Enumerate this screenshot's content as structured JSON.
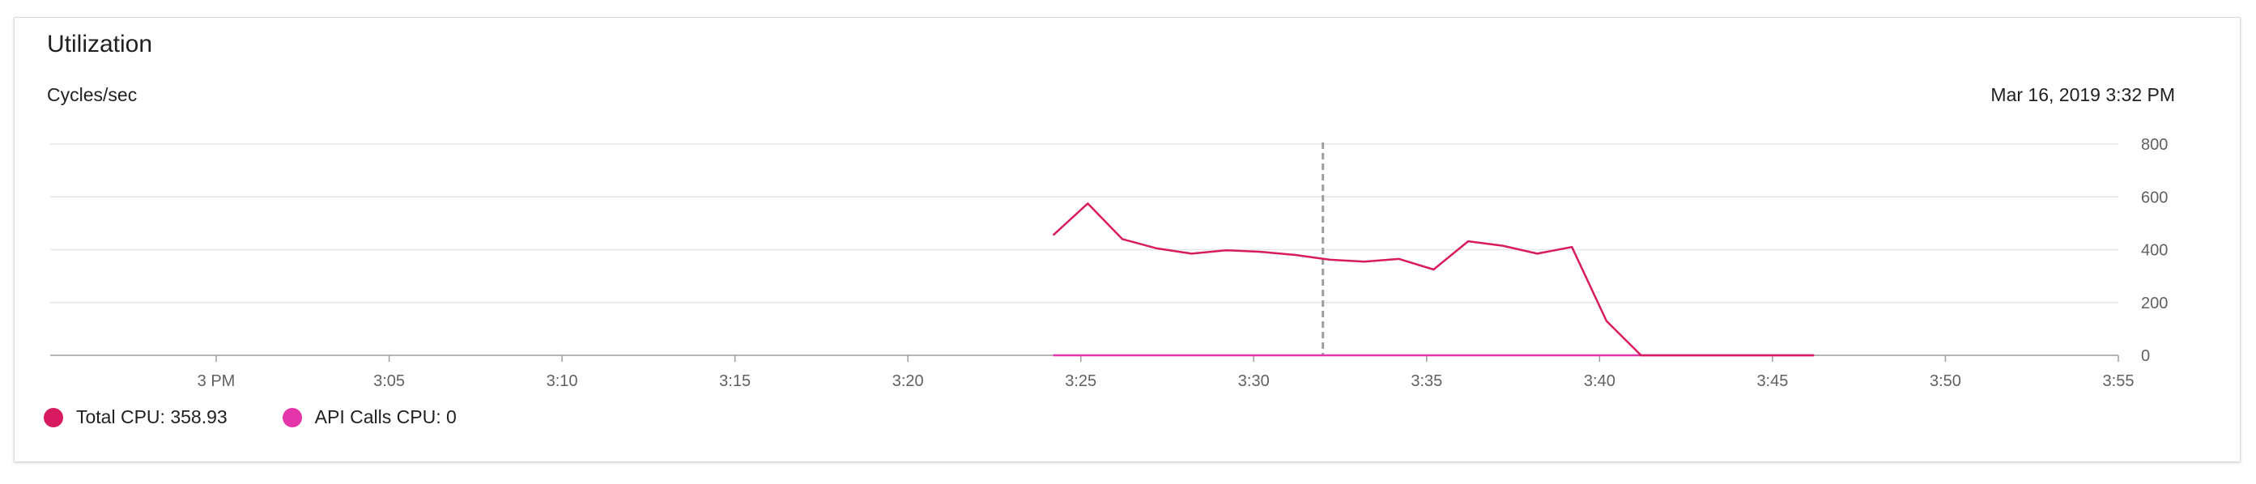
{
  "card": {
    "title": "Utilization",
    "metric_label": "Cycles/sec",
    "timestamp": "Mar 16, 2019 3:32 PM"
  },
  "legend": [
    {
      "label": "Total CPU: 358.93",
      "color": "#d81b60"
    },
    {
      "label": "API Calls CPU: 0",
      "color": "#e535ab"
    }
  ],
  "chart_data": {
    "type": "line",
    "xlabel": "",
    "ylabel": "Cycles/sec",
    "x_ticks": [
      "3 PM",
      "3:05",
      "3:10",
      "3:15",
      "3:20",
      "3:25",
      "3:30",
      "3:35",
      "3:40",
      "3:45",
      "3:50",
      "3:55"
    ],
    "y_ticks": [
      0,
      200,
      400,
      600,
      800
    ],
    "xlim_minutes": [
      -4.8,
      55
    ],
    "ylim": [
      0,
      800
    ],
    "y_axis_position": "right",
    "grid": true,
    "cursor_time": "3:32",
    "cursor_minute": 32,
    "series": [
      {
        "name": "Total CPU",
        "color": "#d81b60",
        "points": [
          [
            24.2,
            455
          ],
          [
            25.2,
            575
          ],
          [
            26.2,
            440
          ],
          [
            27.2,
            405
          ],
          [
            28.2,
            385
          ],
          [
            29.2,
            398
          ],
          [
            30.2,
            392
          ],
          [
            31.2,
            380
          ],
          [
            32.2,
            362
          ],
          [
            33.2,
            355
          ],
          [
            34.2,
            365
          ],
          [
            35.2,
            325
          ],
          [
            36.2,
            432
          ],
          [
            37.2,
            415
          ],
          [
            38.2,
            385
          ],
          [
            39.2,
            410
          ],
          [
            40.2,
            130
          ],
          [
            41.2,
            0
          ],
          [
            42.2,
            0
          ],
          [
            43.2,
            0
          ],
          [
            44.2,
            0
          ],
          [
            45.2,
            0
          ],
          [
            46.2,
            0
          ]
        ]
      },
      {
        "name": "API Calls CPU",
        "color": "#e535ab",
        "points": [
          [
            24.2,
            0
          ],
          [
            26.2,
            0
          ],
          [
            28.2,
            0
          ],
          [
            30.2,
            0
          ],
          [
            32.2,
            0
          ],
          [
            34.2,
            0
          ],
          [
            36.2,
            0
          ],
          [
            38.2,
            0
          ],
          [
            40.2,
            0
          ],
          [
            42.2,
            0
          ],
          [
            44.2,
            0
          ],
          [
            46.2,
            0
          ]
        ]
      }
    ]
  }
}
